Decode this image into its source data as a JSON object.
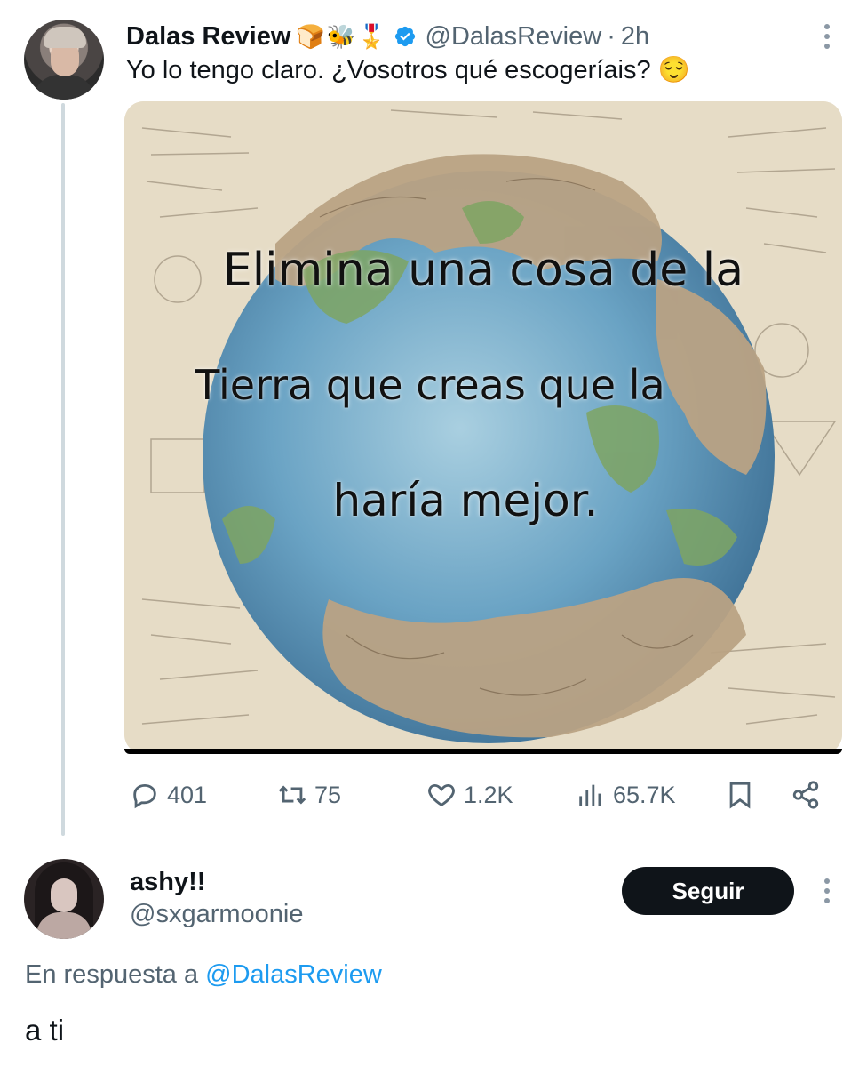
{
  "tweet": {
    "author_name": "Dalas Review",
    "author_emojis": [
      "🍞",
      "🐝",
      "🎖️"
    ],
    "handle": "@DalasReview",
    "separator": "·",
    "time": "2h",
    "text": "Yo lo tengo claro. ¿Vosotros qué escogeríais? 😌",
    "image": {
      "line1": "Elimina una cosa de la",
      "line2": "Tierra que creas que la",
      "line3": "haría mejor."
    },
    "stats": {
      "replies": "401",
      "retweets": "75",
      "likes": "1.2K",
      "views": "65.7K"
    },
    "icons": [
      "reply-icon",
      "retweet-icon",
      "like-icon",
      "views-icon",
      "bookmark-icon",
      "share-icon",
      "verified-badge-icon",
      "more-options-icon"
    ]
  },
  "reply": {
    "author_name": "ashy!!",
    "handle": "@sxgarmoonie",
    "follow_label": "Seguir",
    "in_reply_prefix": "En respuesta a",
    "in_reply_mention": "@DalasReview",
    "text": "a ti"
  },
  "colors": {
    "text_primary": "#0f1419",
    "text_secondary": "#536471",
    "accent": "#1d9bf0",
    "thread_line": "#cfd9de",
    "button_bg": "#0f1419"
  }
}
